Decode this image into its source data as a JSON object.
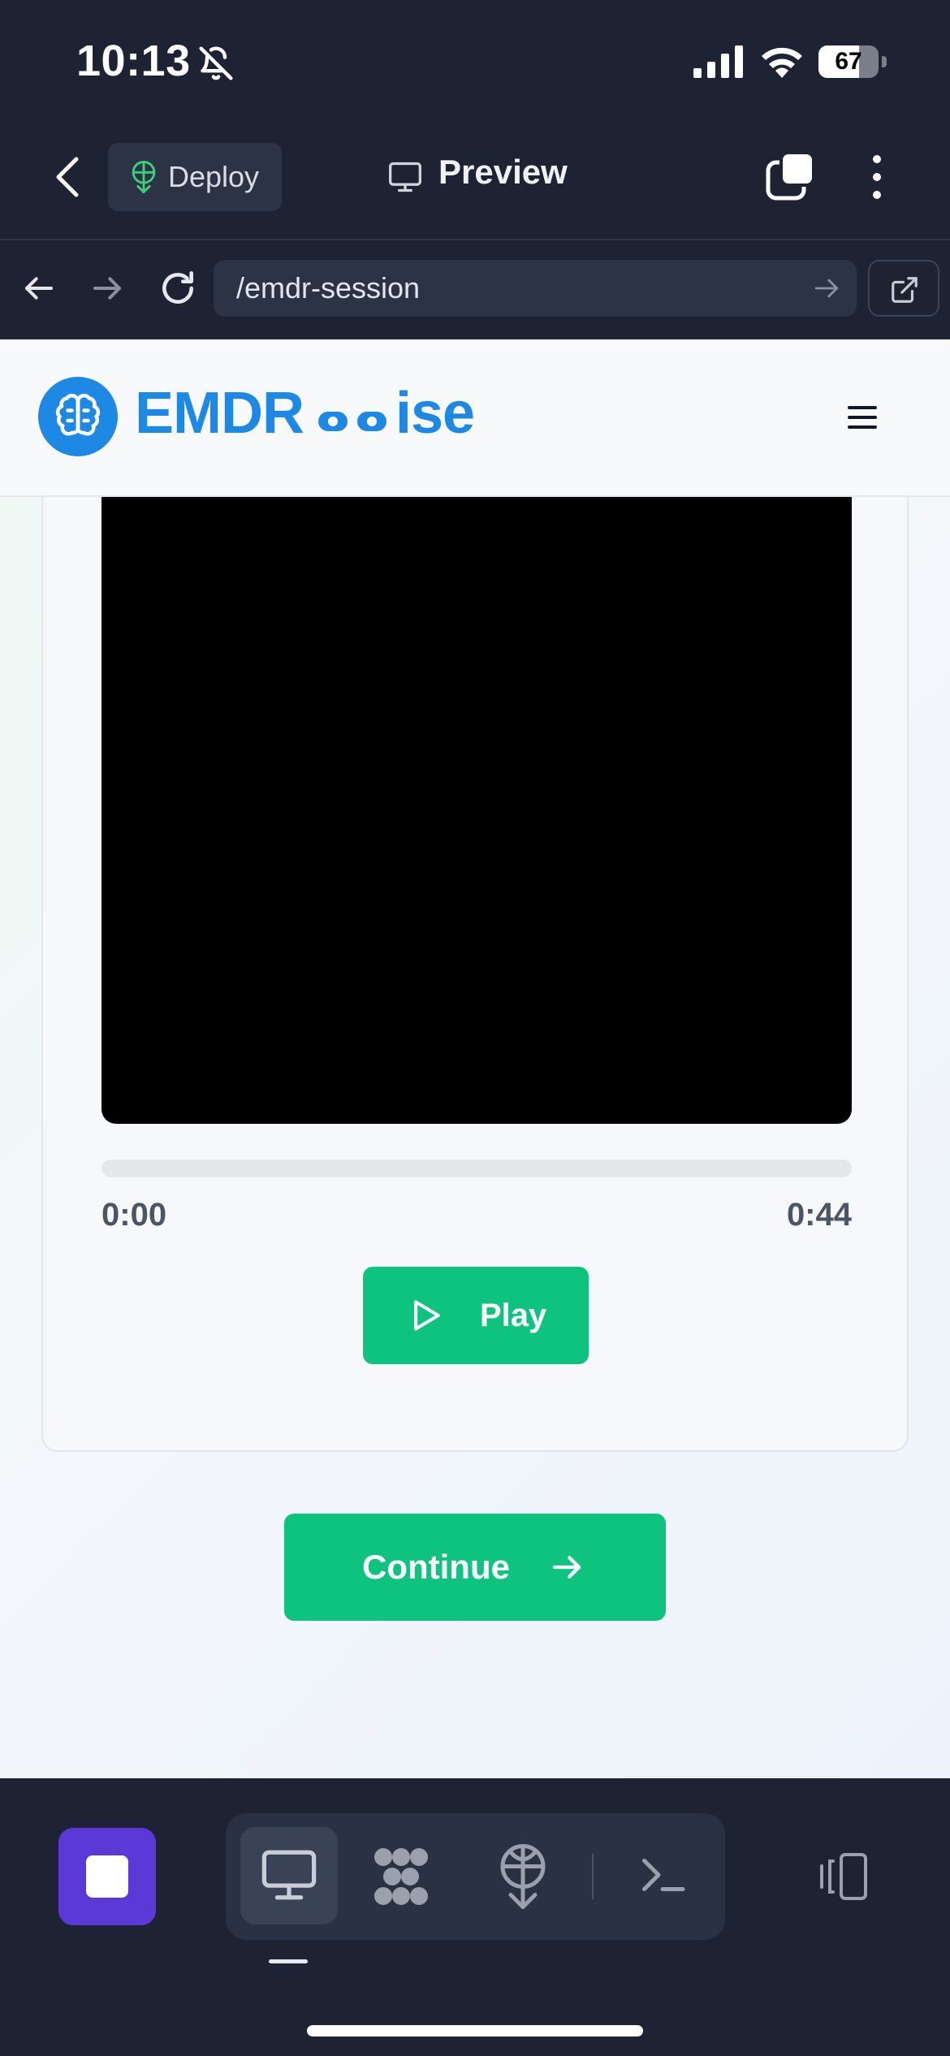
{
  "status_bar": {
    "time": "10:13",
    "battery_level": "67",
    "battery_fraction": 0.67
  },
  "app_header": {
    "deploy_label": "Deploy",
    "preview_label": "Preview"
  },
  "browser": {
    "url": "/emdr-session"
  },
  "site": {
    "logo_text_left": "EMDR",
    "logo_text_right": "ise",
    "brand_color": "#1e88e5"
  },
  "player": {
    "time_current": "0:00",
    "time_total": "0:44",
    "progress": 0,
    "play_label": "Play",
    "accent_color": "#0ec37d"
  },
  "actions": {
    "continue_label": "Continue"
  },
  "toolbar": {
    "icons": [
      "stop-icon",
      "preview-monitor-icon",
      "agent-icon",
      "deploy-icon",
      "shell-icon",
      "panel-toggle-icon"
    ],
    "stop_color": "#5b39d6"
  }
}
